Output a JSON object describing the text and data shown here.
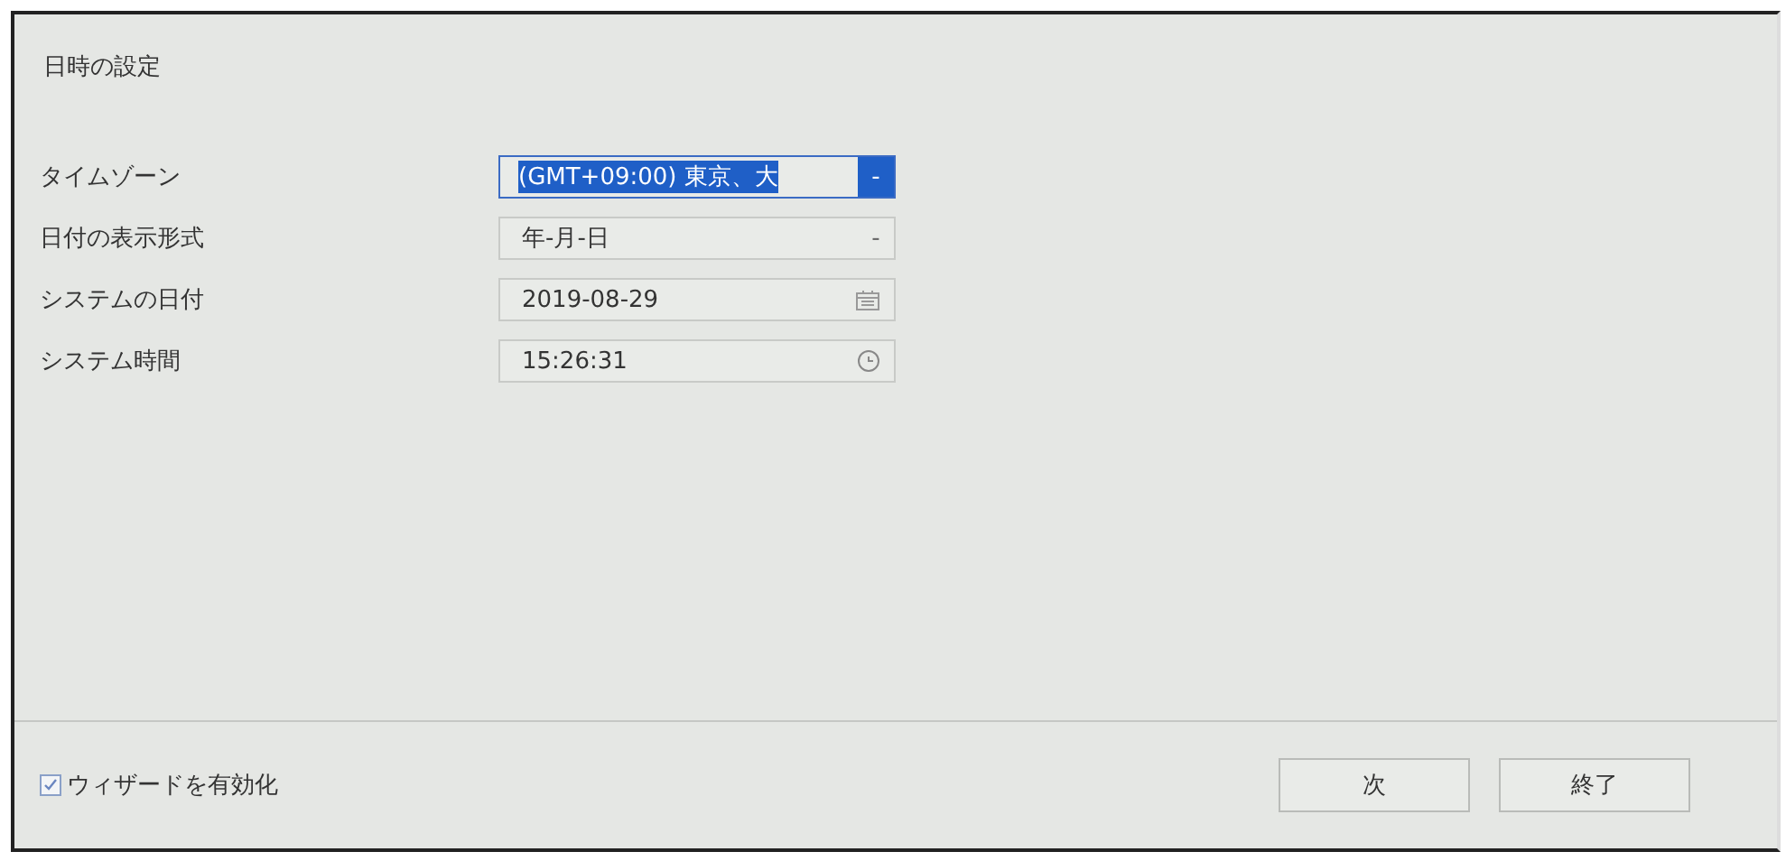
{
  "window": {
    "title": "日時の設定"
  },
  "fields": [
    {
      "label": "タイムゾーン",
      "kind": "dropdown",
      "value": "(GMT+09:00) 東京、大",
      "arrow": "-",
      "focused": true
    },
    {
      "label": "日付の表示形式",
      "kind": "dropdown",
      "value": "年-月-日",
      "arrow": "-",
      "focused": false
    },
    {
      "label": "システムの日付",
      "kind": "date",
      "value": "2019-08-29",
      "focused": false
    },
    {
      "label": "システム時間",
      "kind": "time",
      "value": "15:26:31",
      "focused": false
    }
  ],
  "footer": {
    "wizard": {
      "label": "ウィザードを有効化",
      "checked": true
    },
    "buttons": [
      "次",
      "終了"
    ]
  }
}
